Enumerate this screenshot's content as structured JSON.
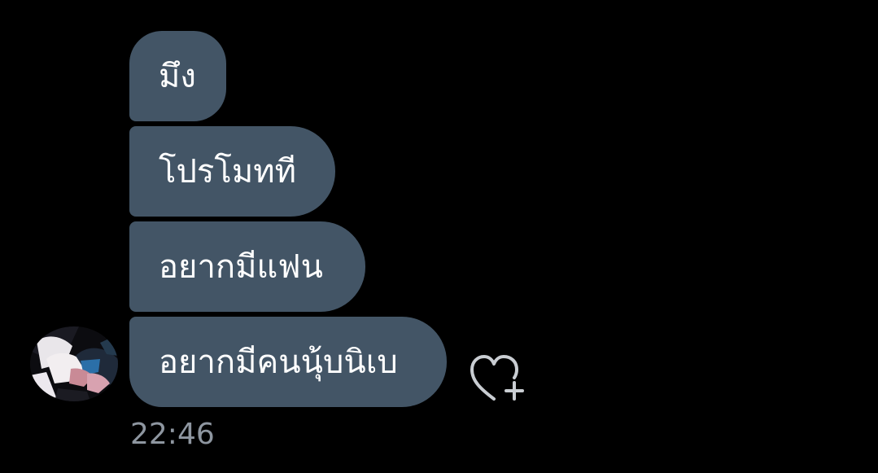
{
  "messages": [
    {
      "text": "มึง"
    },
    {
      "text": "โปรโมทที"
    },
    {
      "text": "อยากมีแฟน"
    },
    {
      "text": "อยากมีคนนุ้บนิเบ"
    }
  ],
  "timestamp": "22:46",
  "icons": {
    "avatar": "avatar",
    "reaction": "heart-add-icon"
  },
  "colors": {
    "background": "#000000",
    "bubble": "#435566",
    "bubble_text": "#ffffff",
    "timestamp": "#8e96a0",
    "icon": "#c9cdd2"
  }
}
